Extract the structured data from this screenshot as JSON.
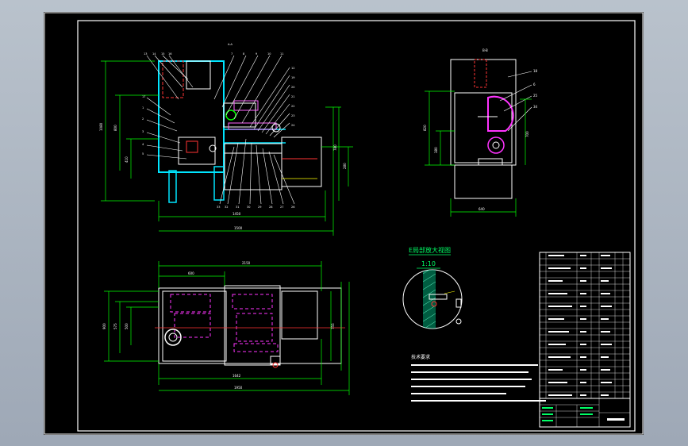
{
  "detail": {
    "title": "E局部放大视图",
    "scale": "1:10"
  },
  "technical_requirements": {
    "heading": "技术要求"
  }
}
